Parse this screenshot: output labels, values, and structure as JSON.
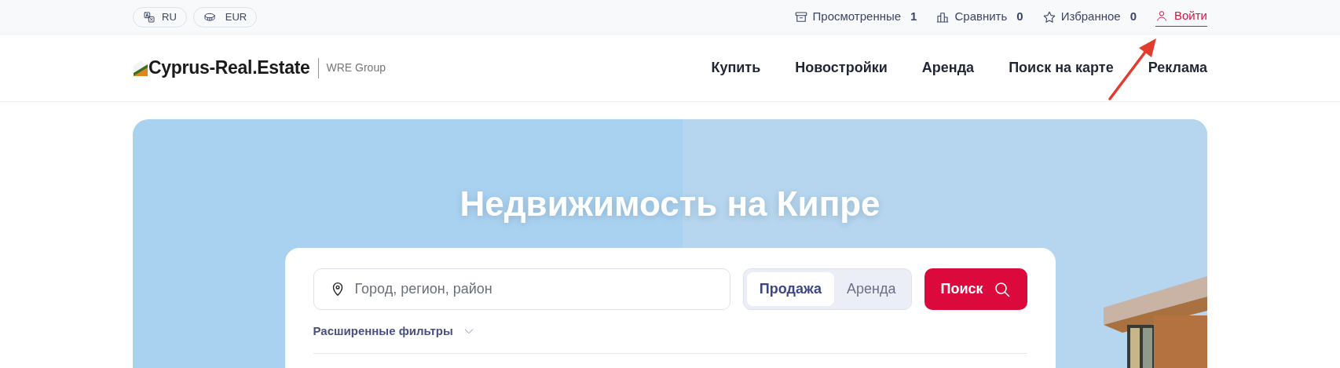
{
  "top_bar": {
    "language": "RU",
    "currency": "EUR",
    "links": [
      {
        "kind": "viewed",
        "label": "Просмотренные",
        "count": "1"
      },
      {
        "kind": "compare",
        "label": "Сравнить",
        "count": "0"
      },
      {
        "kind": "favorites",
        "label": "Избранное",
        "count": "0"
      }
    ],
    "login": "Войти"
  },
  "header": {
    "logo": "Cyprus-Real.Estate",
    "group": "WRE Group",
    "nav": [
      "Купить",
      "Новостройки",
      "Аренда",
      "Поиск на карте",
      "Реклама"
    ]
  },
  "hero": {
    "title": "Недвижимость на Кипре",
    "search": {
      "placeholder": "Город, регион, район",
      "modes": [
        {
          "label": "Продажа",
          "selected": true
        },
        {
          "label": "Аренда",
          "selected": false
        }
      ],
      "button": "Поиск",
      "filters": "Расширенные фильтры"
    }
  }
}
